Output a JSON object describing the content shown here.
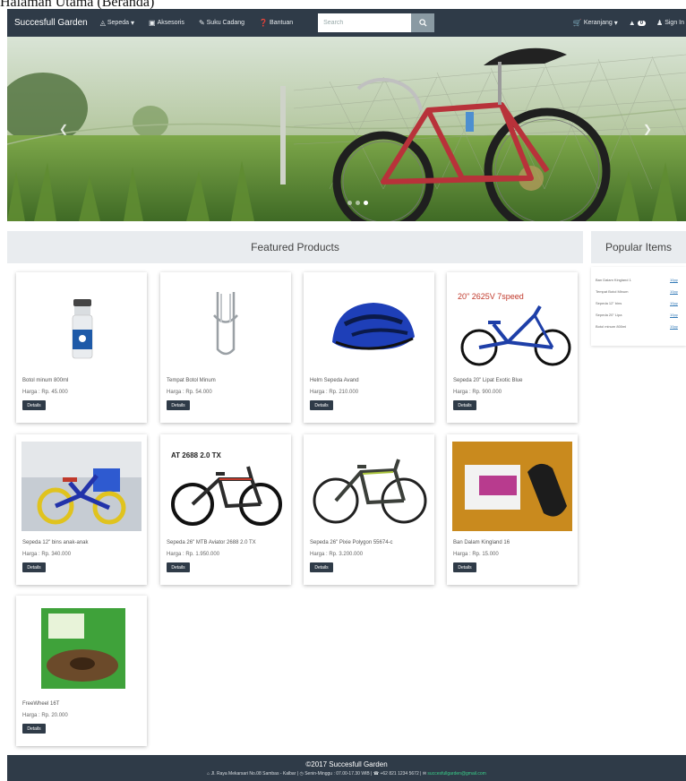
{
  "caption": "Halaman Utama (Beranda)",
  "navbar": {
    "brand": "Succesfull Garden",
    "items": [
      {
        "icon": "bicycle-icon",
        "label": "Sepeda"
      },
      {
        "icon": "box-icon",
        "label": "Aksesoris"
      },
      {
        "icon": "wrench-icon",
        "label": "Suku Cadang"
      },
      {
        "icon": "question-icon",
        "label": "Bantuan"
      }
    ],
    "search_placeholder": "Search",
    "cart_label": "Keranjang",
    "notif_count": "0",
    "signin_label": "Sign In"
  },
  "hero": {
    "slides": 3,
    "active_slide": 2
  },
  "featured": {
    "title": "Featured Products"
  },
  "popular": {
    "title": "Popular Items",
    "items": [
      {
        "name": "Ban Dalam Kingland 1",
        "link": "10pp"
      },
      {
        "name": "Tempat Botol Minum",
        "link": "10pp"
      },
      {
        "name": "Sepeda 12\" bins",
        "link": "10pp"
      },
      {
        "name": "Sepeda 20\" Lipa",
        "link": "10pp"
      },
      {
        "name": "Botol minum 800ml",
        "link": "10pp"
      }
    ]
  },
  "products": [
    {
      "name": "Botol minum 800ml",
      "price": "Harga : Rp. 45.000",
      "image": "bottle",
      "button": "Details"
    },
    {
      "name": "Tempat Botol Minum",
      "price": "Harga : Rp. 54.000",
      "image": "cage",
      "button": "Details"
    },
    {
      "name": "Helm Sepeda Avand",
      "price": "Harga : Rp. 210.000",
      "image": "helmet",
      "button": "Details"
    },
    {
      "name": "Sepeda 20\" Lipat Exotic Blue",
      "price": "Harga : Rp. 900.000",
      "image": "folding",
      "image_text": "20\" 2625V 7speed",
      "button": "Details"
    },
    {
      "name": "Sepeda 12\" bins anak-anak",
      "price": "Harga : Rp. 340.000",
      "image": "kids",
      "button": "Details"
    },
    {
      "name": "Sepeda 26\" MTB Aviator 2688 2.0 TX",
      "price": "Harga : Rp. 1.950.000",
      "image": "mtb",
      "image_text": "AT 2688 2.0 TX",
      "button": "Details"
    },
    {
      "name": "Sepeda 26\" Pixie Polygon 55674-c",
      "price": "Harga : Rp. 3.200.000",
      "image": "road",
      "button": "Details"
    },
    {
      "name": "Ban Dalam Kingland 16",
      "price": "Harga : Rp. 15.000",
      "image": "tube",
      "button": "Details"
    },
    {
      "name": "FreeWheel 16T",
      "price": "Harga : Rp. 20.000",
      "image": "freewheel",
      "button": "Details"
    }
  ],
  "footer": {
    "title": "©2017 Succesfull Garden",
    "address": "Jl. Raya Mekarsari No.08 Sambas - Kalbar",
    "hours": "Senin-Minggu : 07.00-17.30 WIB",
    "phone": "+62 821 1234 5672",
    "email": "succesfullgarden@gmail.com"
  }
}
